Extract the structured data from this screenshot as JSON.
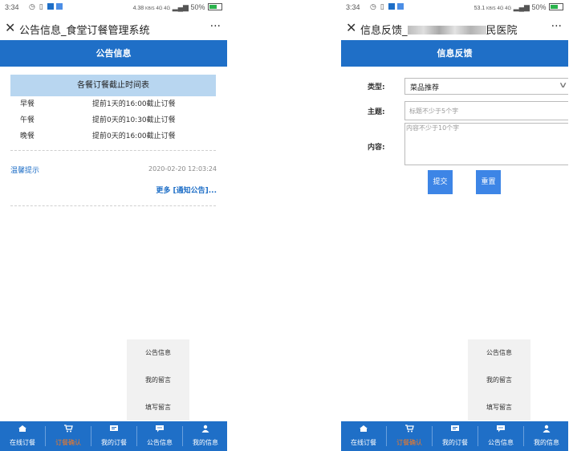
{
  "left": {
    "status": {
      "time": "3:34",
      "net_speed": "4.38",
      "speed_unit": "KB/S",
      "signal": "4G 4G",
      "battery": "50%"
    },
    "title": "公告信息_食堂订餐管理系统",
    "header": "公告信息",
    "table_title": "各餐订餐截止时间表",
    "meals": [
      {
        "meal": "早餐",
        "rule": "提前1天的16:00截止订餐"
      },
      {
        "meal": "午餐",
        "rule": "提前0天的10:30截止订餐"
      },
      {
        "meal": "晚餐",
        "rule": "提前0天的16:00截止订餐"
      }
    ],
    "notice_title": "温馨提示",
    "notice_date": "2020-02-20 12:03:24",
    "more_link": "更多 [通知公告]..."
  },
  "right": {
    "status": {
      "time": "3:34",
      "net_speed": "53.1",
      "speed_unit": "KB/S",
      "signal": "4G 4G",
      "battery": "50%"
    },
    "title_prefix": "信息反馈_",
    "title_suffix": "民医院",
    "header": "信息反馈",
    "form": {
      "type_label": "类型:",
      "type_value": "菜品推荐",
      "subject_label": "主题:",
      "subject_placeholder": "标题不少于5个字",
      "content_label": "内容:",
      "content_placeholder": "内容不少于10个字",
      "submit": "提交",
      "reset": "重置"
    }
  },
  "popup_menu": [
    "公告信息",
    "我的留言",
    "填写留言"
  ],
  "bottom_nav": [
    {
      "label": "在线订餐",
      "icon": "home-icon",
      "active": false
    },
    {
      "label": "订餐确认",
      "icon": "cart-icon",
      "active": true
    },
    {
      "label": "我的订餐",
      "icon": "order-list-icon",
      "active": false
    },
    {
      "label": "公告信息",
      "icon": "message-icon",
      "active": false
    },
    {
      "label": "我的信息",
      "icon": "user-icon",
      "active": false
    }
  ],
  "colors": {
    "primary": "#1f6fc7",
    "table_header": "#b8d6f0",
    "active_nav": "#ff7a1a",
    "button": "#3d85e6",
    "popup_bg": "#f1f1f1"
  }
}
